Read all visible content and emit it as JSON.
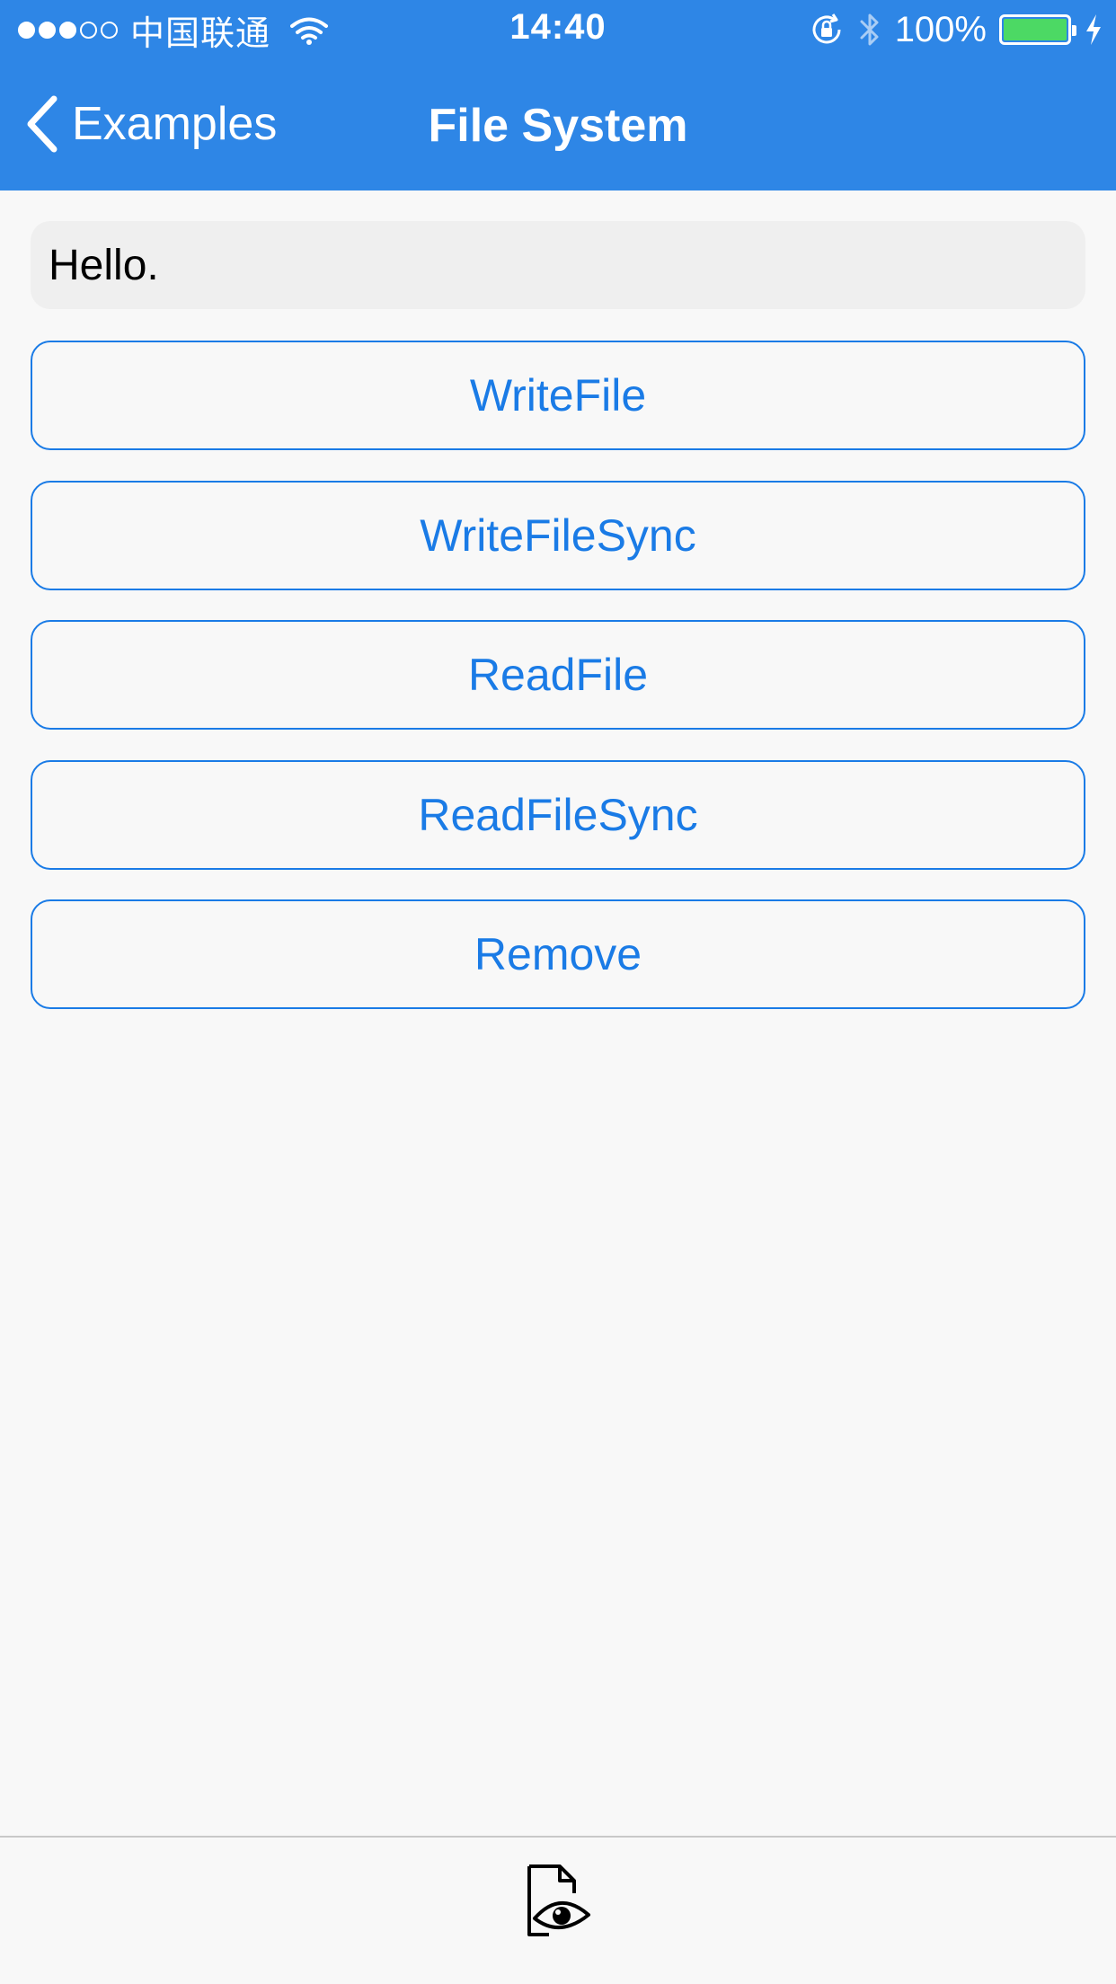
{
  "status_bar": {
    "carrier": "中国联通",
    "time": "14:40",
    "battery_percent": "100%",
    "battery_level": 1.0,
    "signal_bars_filled": 3,
    "signal_bars_total": 5
  },
  "nav": {
    "back_label": "Examples",
    "title": "File System"
  },
  "content": {
    "display_text": "Hello.",
    "buttons": [
      {
        "label": "WriteFile"
      },
      {
        "label": "WriteFileSync"
      },
      {
        "label": "ReadFile"
      },
      {
        "label": "ReadFileSync"
      },
      {
        "label": "Remove"
      }
    ]
  },
  "tab_bar": {
    "icon": "file-preview-icon"
  },
  "colors": {
    "header_bg": "#2e86e6",
    "accent": "#1a7be6",
    "battery_fill": "#4cd964",
    "page_bg": "#f8f8f8",
    "display_bg": "#efefef"
  }
}
